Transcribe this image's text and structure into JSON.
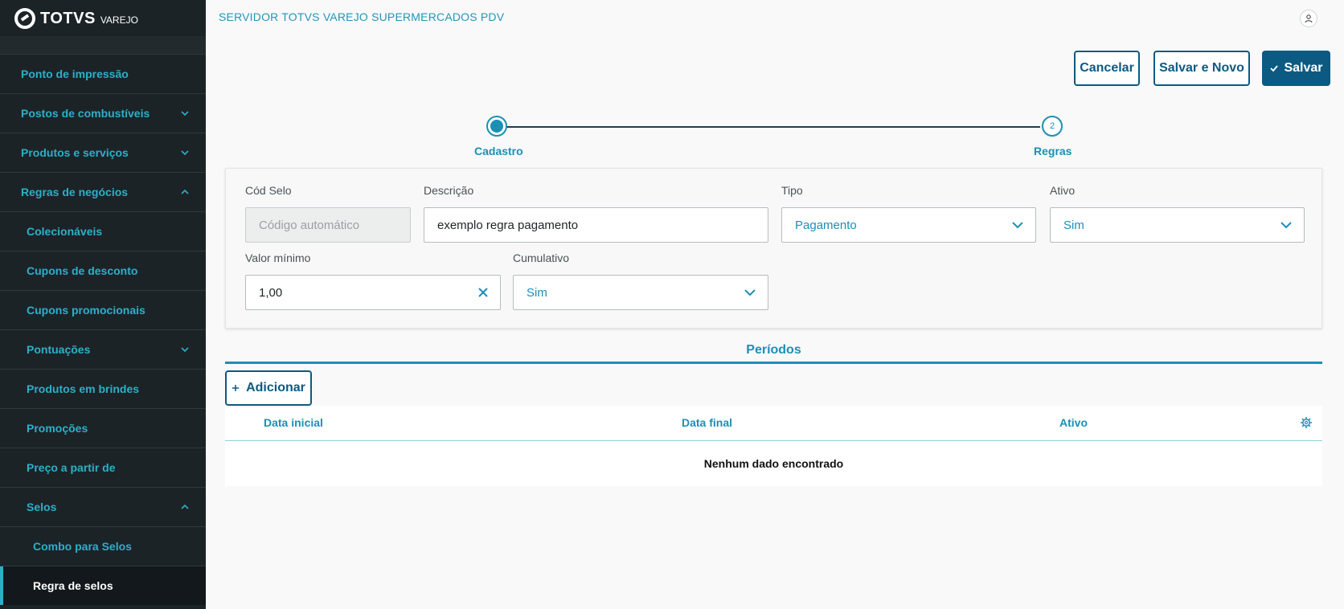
{
  "brand": {
    "name": "TOTVS",
    "sub": "VAREJO"
  },
  "header": {
    "title": "SERVIDOR TOTVS VAREJO SUPERMERCADOS PDV"
  },
  "sidebar": {
    "items": [
      {
        "label": "Ponto de impressão",
        "chevron": "none"
      },
      {
        "label": "Postos de combustíveis",
        "chevron": "down"
      },
      {
        "label": "Produtos e serviços",
        "chevron": "down"
      },
      {
        "label": "Regras de negócios",
        "chevron": "up"
      },
      {
        "label": "Colecionáveis",
        "chevron": "none"
      },
      {
        "label": "Cupons de desconto",
        "chevron": "none"
      },
      {
        "label": "Cupons promocionais",
        "chevron": "none"
      },
      {
        "label": "Pontuações",
        "chevron": "down"
      },
      {
        "label": "Produtos em brindes",
        "chevron": "none"
      },
      {
        "label": "Promoções",
        "chevron": "none"
      },
      {
        "label": "Preço a partir de",
        "chevron": "none"
      },
      {
        "label": "Selos",
        "chevron": "up"
      },
      {
        "label": "Combo para Selos",
        "chevron": "none"
      },
      {
        "label": "Regra de selos",
        "chevron": "none",
        "active": true
      }
    ]
  },
  "actions": {
    "cancel": "Cancelar",
    "save_new": "Salvar e Novo",
    "save": "Salvar"
  },
  "stepper": {
    "step1": "Cadastro",
    "step2": "Regras",
    "step2_number": "2"
  },
  "form": {
    "cod_selo": {
      "label": "Cód Selo",
      "placeholder": "Código automático"
    },
    "descricao": {
      "label": "Descrição",
      "value": "exemplo regra pagamento"
    },
    "tipo": {
      "label": "Tipo",
      "value": "Pagamento"
    },
    "ativo": {
      "label": "Ativo",
      "value": "Sim"
    },
    "valor_minimo": {
      "label": "Valor mínimo",
      "value": "1,00"
    },
    "cumulativo": {
      "label": "Cumulativo",
      "value": "Sim"
    }
  },
  "tabs": {
    "periodos": "Períodos"
  },
  "periodos": {
    "add_label": "Adicionar",
    "columns": [
      "Data inicial",
      "Data final",
      "Ativo"
    ],
    "empty": "Nenhum dado encontrado"
  },
  "colors": {
    "accent": "#1c8fb5",
    "primary": "#0c5a82",
    "sidebar_bg": "#1c2327"
  }
}
